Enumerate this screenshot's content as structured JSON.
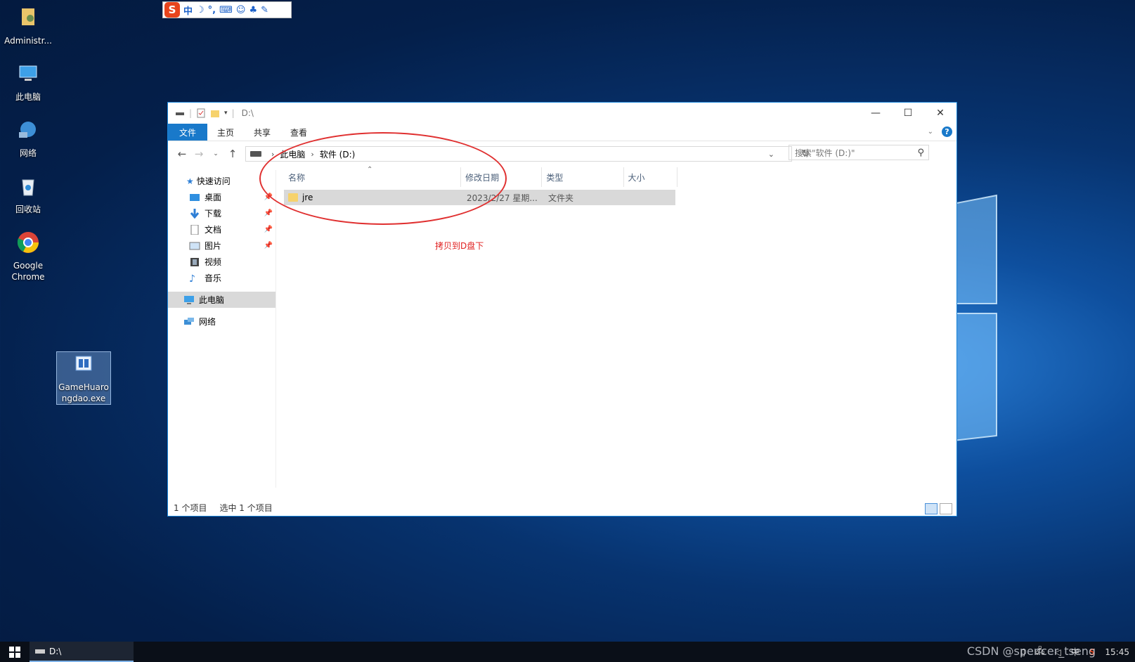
{
  "desktop": {
    "icons": [
      {
        "label": "Administr..."
      },
      {
        "label": "此电脑"
      },
      {
        "label": "网络"
      },
      {
        "label": "回收站"
      },
      {
        "label": "Google Chrome"
      },
      {
        "label": "GameHuarongdao.exe"
      }
    ]
  },
  "ime": {
    "logo": "S",
    "mode": "中"
  },
  "window": {
    "title": "D:\\",
    "ribbon_tabs": [
      "文件",
      "主页",
      "共享",
      "查看"
    ],
    "breadcrumb": [
      "此电脑",
      "软件 (D:)"
    ],
    "search_placeholder": "搜索\"软件 (D:)\"",
    "nav_pane": {
      "quick_access": "快速访问",
      "items": [
        "桌面",
        "下载",
        "文档",
        "图片",
        "视频",
        "音乐"
      ],
      "this_pc": "此电脑",
      "network": "网络"
    },
    "columns": [
      "名称",
      "修改日期",
      "类型",
      "大小"
    ],
    "files": [
      {
        "name": "jre",
        "modified": "2023/2/27 星期...",
        "type": "文件夹",
        "size": ""
      }
    ],
    "annotation": "拷贝到D盘下",
    "status": {
      "count": "1 个项目",
      "selected": "选中 1 个项目"
    }
  },
  "taskbar": {
    "task_label": "D:\\",
    "clock": "15:45",
    "ime_indicator": "中"
  },
  "watermark": "CSDN @spencer_tseng"
}
